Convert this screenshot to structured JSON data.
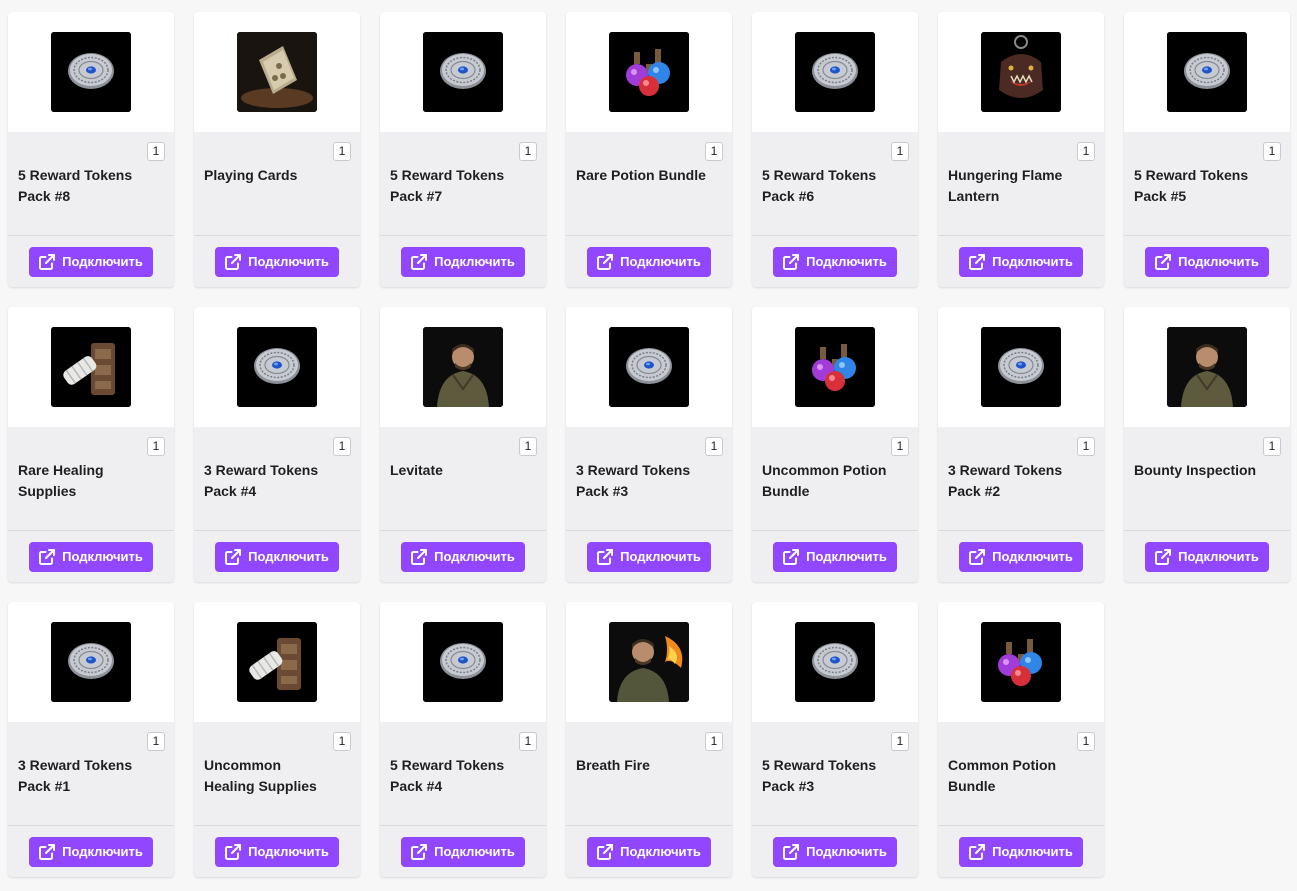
{
  "button_label": "Подключить",
  "accent_color": "#9147ff",
  "items": [
    {
      "title": "5 Reward Tokens Pack #8",
      "count": "1",
      "icon": "coin-icon"
    },
    {
      "title": "Playing Cards",
      "count": "1",
      "icon": "cards-icon"
    },
    {
      "title": "5 Reward Tokens Pack #7",
      "count": "1",
      "icon": "coin-icon"
    },
    {
      "title": "Rare Potion Bundle",
      "count": "1",
      "icon": "potion-icon"
    },
    {
      "title": "5 Reward Tokens Pack #6",
      "count": "1",
      "icon": "coin-icon"
    },
    {
      "title": "Hungering Flame Lantern",
      "count": "1",
      "icon": "lantern-icon"
    },
    {
      "title": "5 Reward Tokens Pack #5",
      "count": "1",
      "icon": "coin-icon"
    },
    {
      "title": "Rare Healing Supplies",
      "count": "1",
      "icon": "supplies-icon"
    },
    {
      "title": "3 Reward Tokens Pack #4",
      "count": "1",
      "icon": "coin-icon"
    },
    {
      "title": "Levitate",
      "count": "1",
      "icon": "character-icon"
    },
    {
      "title": "3 Reward Tokens Pack #3",
      "count": "1",
      "icon": "coin-icon"
    },
    {
      "title": "Uncommon Potion Bundle",
      "count": "1",
      "icon": "potion-icon"
    },
    {
      "title": "3 Reward Tokens Pack #2",
      "count": "1",
      "icon": "coin-icon"
    },
    {
      "title": "Bounty Inspection",
      "count": "1",
      "icon": "character-icon"
    },
    {
      "title": "3 Reward Tokens Pack #1",
      "count": "1",
      "icon": "coin-icon"
    },
    {
      "title": "Uncommon Healing Supplies",
      "count": "1",
      "icon": "supplies-icon"
    },
    {
      "title": "5 Reward Tokens Pack #4",
      "count": "1",
      "icon": "coin-icon"
    },
    {
      "title": "Breath Fire",
      "count": "1",
      "icon": "fire-icon"
    },
    {
      "title": "5 Reward Tokens Pack #3",
      "count": "1",
      "icon": "coin-icon"
    },
    {
      "title": "Common Potion Bundle",
      "count": "1",
      "icon": "potion-icon"
    }
  ]
}
